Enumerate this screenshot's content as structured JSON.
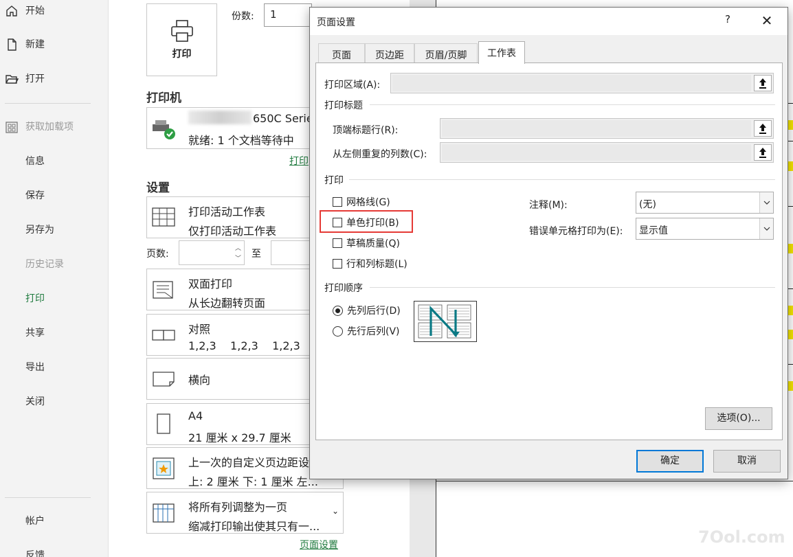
{
  "nav": {
    "items": [
      {
        "label": "开始",
        "state": "normal",
        "icon": "home-icon"
      },
      {
        "label": "新建",
        "state": "normal",
        "icon": "new-file-icon"
      },
      {
        "label": "打开",
        "state": "normal",
        "icon": "open-folder-icon"
      },
      {
        "label": "获取加载项",
        "state": "disabled",
        "icon": "addins-icon"
      },
      {
        "label": "信息",
        "state": "normal"
      },
      {
        "label": "保存",
        "state": "normal"
      },
      {
        "label": "另存为",
        "state": "normal"
      },
      {
        "label": "历史记录",
        "state": "disabled"
      },
      {
        "label": "打印",
        "state": "active"
      },
      {
        "label": "共享",
        "state": "normal"
      },
      {
        "label": "导出",
        "state": "normal"
      },
      {
        "label": "关闭",
        "state": "normal"
      },
      {
        "label": "帐户",
        "state": "normal"
      },
      {
        "label": "反馈",
        "state": "normal"
      }
    ]
  },
  "print": {
    "button_label": "打印",
    "copies_label": "份数:",
    "copies_value": "1",
    "printer_heading": "打印机",
    "printer_name": "650C Serie",
    "printer_status": "就绪: 1 个文档等待中",
    "printer_props_link": "打印",
    "settings_heading": "设置",
    "options": [
      {
        "line1": "打印活动工作表",
        "line2": "仅打印活动工作表",
        "icon": "sheet-grid-icon"
      },
      {
        "line1": "双面打印",
        "line2": "从长边翻转页面",
        "icon": "duplex-icon"
      },
      {
        "line1": "对照",
        "line2": "1,2,3    1,2,3    1,2,3",
        "icon": "collate-icon"
      },
      {
        "line1": "横向",
        "line2": "",
        "icon": "landscape-icon"
      },
      {
        "line1": "A4",
        "line2": "21 厘米 x 29.7 厘米",
        "icon": "paper-size-icon"
      },
      {
        "line1": "上一次的自定义页边距设",
        "line2": "上: 2 厘米 下: 1 厘米 左...",
        "icon": "margins-icon"
      },
      {
        "line1": "将所有列调整为一页",
        "line2": "缩减打印输出使其只有一...",
        "icon": "scaling-icon"
      }
    ],
    "pages_label": "页数:",
    "pages_to": "至",
    "page_setup_link": "页面设置"
  },
  "dialog": {
    "title": "页面设置",
    "help": "?",
    "close": "✕",
    "tabs": [
      "页面",
      "页边距",
      "页眉/页脚",
      "工作表"
    ],
    "active_tab": 3,
    "print_area_label": "打印区域(A):",
    "print_titles_group": "打印标题",
    "rows_repeat_label": "顶端标题行(R):",
    "cols_repeat_label": "从左侧重复的列数(C):",
    "print_group": "打印",
    "checkboxes": [
      {
        "label": "网格线(G)",
        "checked": false
      },
      {
        "label": "单色打印(B)",
        "checked": false
      },
      {
        "label": "草稿质量(Q)",
        "checked": false
      },
      {
        "label": "行和列标题(L)",
        "checked": false
      }
    ],
    "comments_label": "注释(M):",
    "comments_value": "(无)",
    "errors_label": "错误单元格打印为(E):",
    "errors_value": "显示值",
    "order_group": "打印顺序",
    "order_options": [
      {
        "label": "先列后行(D)",
        "selected": true
      },
      {
        "label": "先行后列(V)",
        "selected": false
      }
    ],
    "options_button": "选项(O)...",
    "ok_button": "确定",
    "cancel_button": "取消"
  },
  "watermark": "7Ool.com",
  "colors": {
    "accent_green": "#1f7a3e",
    "highlight_red": "#e53935",
    "focus_blue": "#0078d7"
  }
}
